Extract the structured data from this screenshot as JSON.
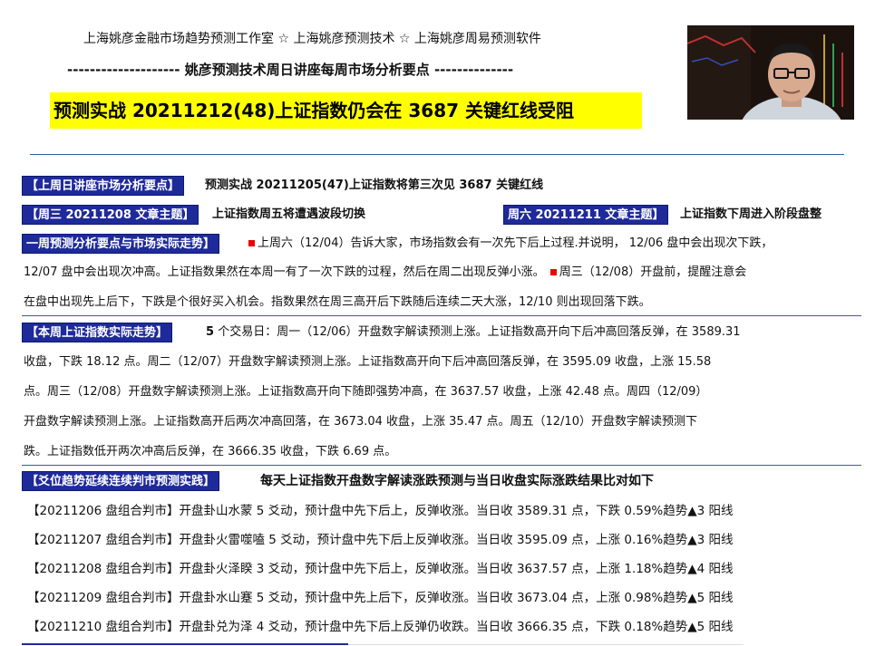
{
  "header": {
    "studio_line": "上海姚彦金融市场趋势预测工作室 ☆ 上海姚彦预测技术 ☆ 上海姚彦周易预测软件",
    "subtitle": "-------------------- 姚彦预测技术周日讲座每周市场分析要点 --------------",
    "title": "预测实战 20211212(48)上证指数仍会在 3687 关键红线受阻"
  },
  "last_week_point": {
    "tag": "【上周日讲座市场分析要点】",
    "text": "预测实战 20211205(47)上证指数将第三次见 3687 关键红线"
  },
  "wednesday": {
    "tag": "【周三 20211208 文章主题】",
    "text": "上证指数周五将遭遇波段切换"
  },
  "saturday": {
    "tag": "周六 20211211 文章主题】",
    "text": "上证指数下周进入阶段盘整"
  },
  "weekly_prediction": {
    "tag": "一周预测分析要点与市场实际走势】",
    "line1": "上周六（12/04）告诉大家，市场指数会有一次先下后上过程.并说明， 12/06 盘中会出现次下跌，",
    "line2_a": "12/07 盘中会出现次冲高。上证指数果然在本周一有了一次下跌的过程，然后在周二出现反弹小涨。",
    "line2_b": "周三（12/08）开盘前，提醒注意会",
    "line3": "在盘中出现先上后下，下跌是个很好买入机会。指数果然在周三高开后下跌随后连续二天大涨，12/10 则出现回落下跌。"
  },
  "actual_trend": {
    "tag": "【本周上证指数实际走势】",
    "line1_bold": "5",
    "line1": "个交易日：周一（12/06）开盘数字解读预测上涨。上证指数高开向下后冲高回落反弹，在 3589.31",
    "line2": "收盘，下跌 18.12 点。周二（12/07）开盘数字解读预测上涨。上证指数高开向下后冲高回落反弹，在 3595.09 收盘，上涨 15.58",
    "line3": "点。周三（12/08）开盘数字解读预测上涨。上证指数高开向下随即强势冲高，在 3637.57 收盘，上涨 42.48 点。周四（12/09）",
    "line4": "开盘数字解读预测上涨。上证指数高开后两次冲高回落，在 3673.04 收盘，上涨 35.47 点。周五（12/10）开盘数字解读预测下",
    "line5": "跌。上证指数低开两次冲高后反弹，在 3666.35 收盘，下跌 6.69 点。"
  },
  "yao_section": {
    "tag": "【爻位趋势延续连续判市预测实践】",
    "text": "每天上证指数开盘数字解读涨跌预测与当日收盘实际涨跌结果比对如下"
  },
  "daily_records": [
    "【20211206 盘组合判市】开盘卦山水蒙 5 爻动，预计盘中先下后上，反弹收涨。当日收 3589.31 点，下跌 0.59%趋势▲3 阳线",
    "【20211207 盘组合判市】开盘卦火雷噬嗑 5 爻动，预计盘中先下后上反弹收涨。当日收 3595.09 点，上涨 0.16%趋势▲3 阳线",
    "【20211208 盘组合判市】开盘卦火泽睽 3 爻动，预计盘中先下后上，反弹收涨。当日收 3637.57 点，上涨 1.18%趋势▲4 阳线",
    "【20211209 盘组合判市】开盘卦水山蹇 5 爻动，预计盘中先上后下，反弹收涨。当日收 3673.04 点，上涨 0.98%趋势▲5 阳线",
    "【20211210 盘组合判市】开盘卦兑为泽 4 爻动，预计盘中先下后上反弹仍收跌。当日收 3666.35 点，下跌 0.18%趋势▲5 阳线"
  ],
  "colors": {
    "tag_bg": "#1f2a9a",
    "title_bg": "#ffff00",
    "rule": "#2f5fae",
    "bullet": "#ee0000"
  }
}
